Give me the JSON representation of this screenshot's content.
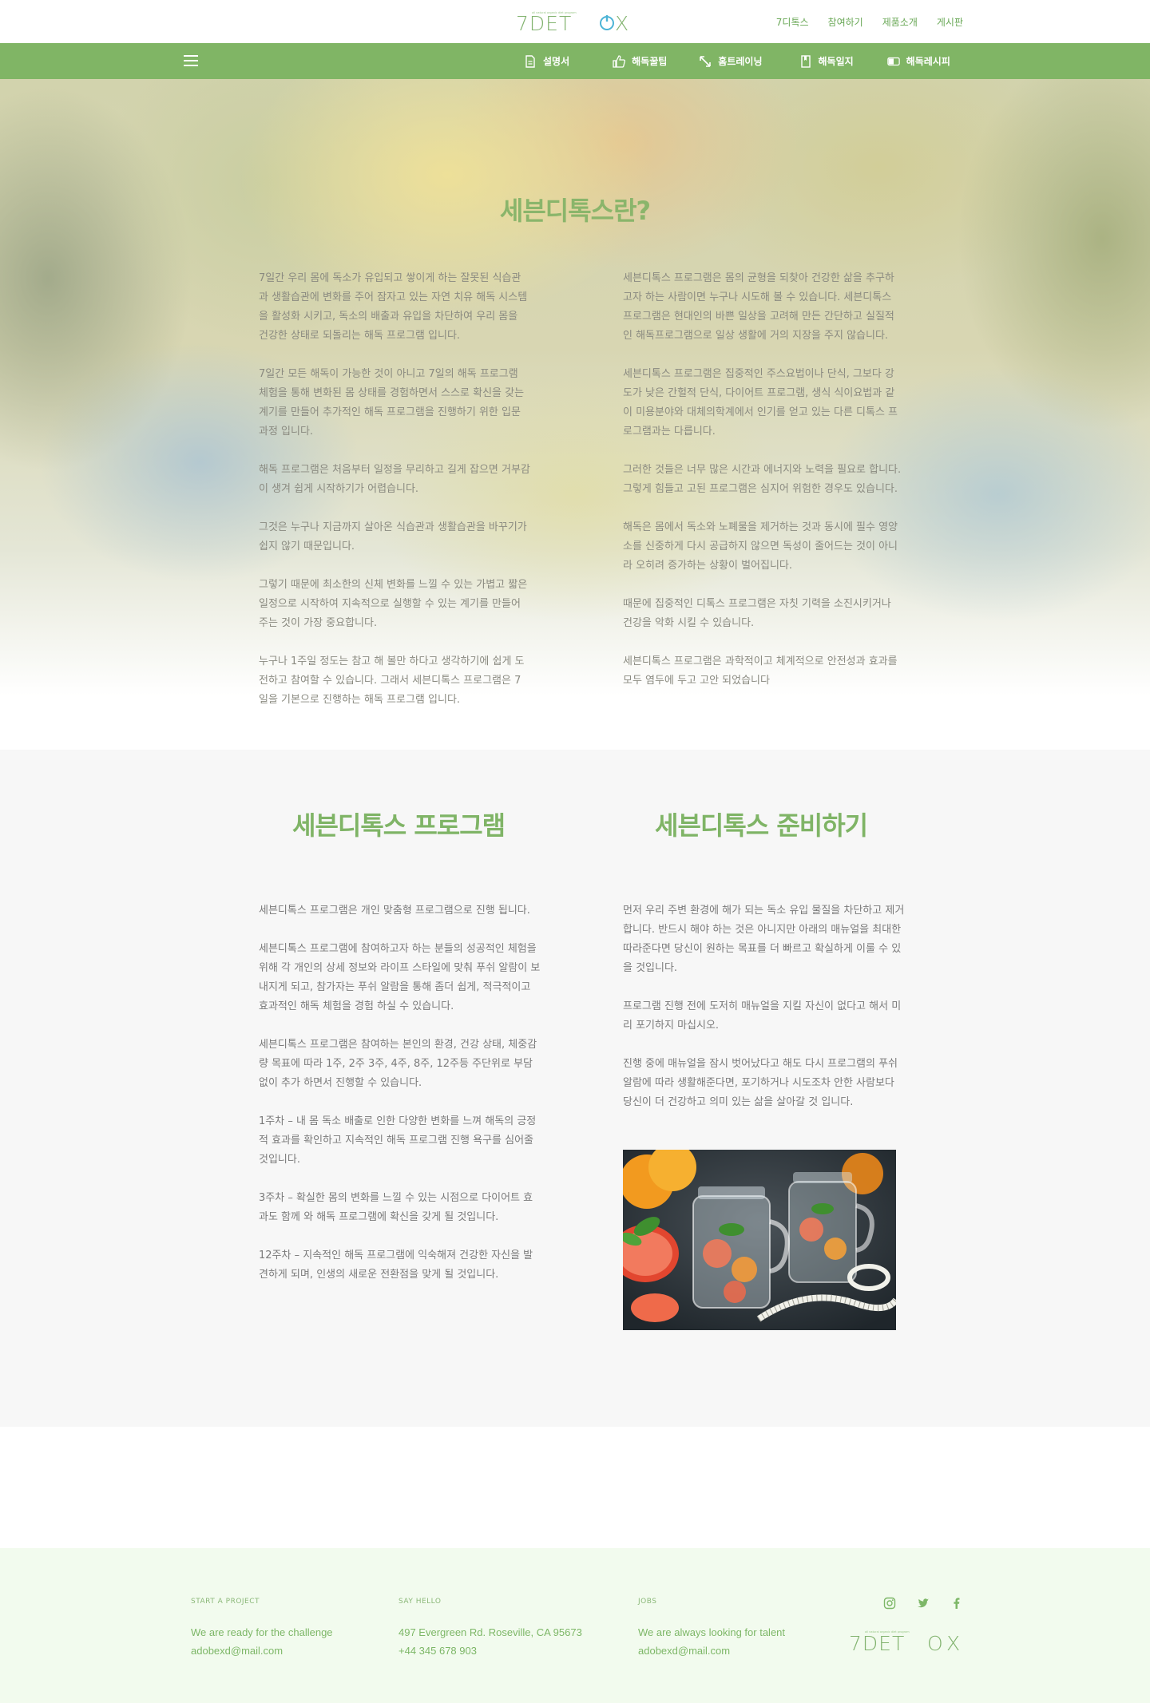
{
  "header": {
    "logo": {
      "tagline": "all natural organic diet program",
      "text_pre": "7DET",
      "text_o": "O",
      "text_post": "X"
    },
    "topnav": [
      "7디톡스",
      "참여하기",
      "제품소개",
      "게시판"
    ],
    "subnav": [
      {
        "label": "설명서",
        "icon": "document-icon"
      },
      {
        "label": "해독꿀팁",
        "icon": "thumbs-up-icon"
      },
      {
        "label": "홈트레이닝",
        "icon": "expand-icon"
      },
      {
        "label": "해독일지",
        "icon": "bookmark-icon"
      },
      {
        "label": "해독레시피",
        "icon": "toggle-icon"
      }
    ],
    "colors": {
      "green_bar": "#80b565",
      "accent": "#7fb466",
      "logo_power": "#4cb4d6"
    }
  },
  "hero": {
    "title": "세븐디톡스란?",
    "left_paragraphs": [
      "7일간 우리 몸에 독소가 유입되고 쌓이게 하는 잘못된 식습관과 생활습관에 변화를 주어 잠자고 있는 자연 치유 해독 시스템을 활성화 시키고, 독소의 배출과 유입을 차단하여 우리 몸을 건강한 상태로 되돌리는 해독 프로그램 입니다.",
      "7일간 모든 해독이 가능한 것이 아니고 7일의 해독 프로그램 체험을 통해 변화된 몸 상태를 경험하면서 스스로 확신을 갖는 계기를 만들어 추가적인 해독 프로그램을 진행하기 위한 입문 과정 입니다.",
      "해독 프로그램은 처음부터 일정을 무리하고 길게 잡으면 거부감이 생겨 쉽게 시작하기가 어렵습니다.",
      "그것은 누구나 지금까지 살아온 식습관과 생활습관을 바꾸기가 쉽지 않기 때문입니다.",
      "그렇기 때문에 최소한의 신체 변화를 느낄 수 있는 가볍고 짧은 일정으로 시작하여 지속적으로 실행할 수 있는 계기를 만들어 주는 것이 가장 중요합니다.",
      "누구나 1주일 정도는 참고 해 볼만 하다고 생각하기에 쉽게 도전하고 참여할 수 있습니다. 그래서 세븐디톡스 프로그램은 7일을 기본으로 진행하는 해독 프로그램 입니다."
    ],
    "right_paragraphs": [
      "세븐디톡스 프로그램은 몸의 균형을 되찾아 건강한 삶을 추구하고자 하는 사람이면 누구나 시도해 볼 수 있습니다. 세븐디톡스 프로그램은 현대인의 바쁜 일상을 고려해 만든 간단하고 실질적인 해독프로그램으로 일상 생활에 거의 지장을 주지 않습니다.",
      "세븐디톡스 프로그램은 집중적인 주스요법이나 단식, 그보다 강도가 낮은 간헐적 단식, 다이어트 프로그램, 생식 식이요법과 같이 미용분야와 대체의학계에서 인기를 얻고 있는 다른 디톡스 프로그램과는 다릅니다.",
      "그러한 것들은 너무 많은 시간과 에너지와 노력을 필요로 합니다. 그렇게 힘들고 고된 프로그램은 심지어 위험한 경우도 있습니다.",
      "해독은 몸에서 독소와 노폐물을 제거하는 것과 동시에 필수 영양소를 신중하게 다시 공급하지 않으면 독성이 줄어드는 것이 아니라 오히려 증가하는 상황이 벌어집니다.",
      "때문에 집중적인 디톡스 프로그램은 자칫 기력을 소진시키거나 건강을 악화 시킬 수 있습니다.",
      "세븐디톡스 프로그램은 과학적이고 체계적으로 안전성과 효과를 모두 염두에 두고 고안 되었습니다"
    ]
  },
  "program": {
    "left_title": "세븐디톡스 프로그램",
    "right_title": "세븐디톡스 준비하기",
    "left_paragraphs": [
      "세븐디톡스 프로그램은 개인 맞춤형 프로그램으로 진행 됩니다.",
      "세븐디톡스 프로그램에 참여하고자 하는 분들의 성공적인 체험을 위해 각 개인의 상세 정보와 라이프 스타일에 맞춰 푸쉬 알람이 보내지게 되고, 참가자는 푸쉬 알람을 통해 좀더 쉽게, 적극적이고 효과적인 해독 체험을 경험 하실 수 있습니다.",
      "세븐디톡스 프로그램은 참여하는 본인의 환경, 건강 상태, 체중감량 목표에 따라 1주, 2주 3주, 4주, 8주, 12주등 주단위로 부담 없이 추가 하면서 진행할 수 있습니다.",
      "1주차 – 내 몸 독소 배출로 인한 다양한 변화를 느껴 해독의 긍정적 효과를 확인하고 지속적인 해독 프로그램 진행 욕구를 심어줄 것입니다.",
      "3주차 – 확실한 몸의 변화를 느낄 수 있는 시점으로 다이어트 효과도 함께 와 해독 프로그램에 확신을 갖게 될 것입니다.",
      "12주차 – 지속적인 해독 프로그램에 익숙해져 건강한 자신을 발견하게 되며, 인생의 새로운 전환점을 맞게 될 것입니다."
    ],
    "right_paragraphs": [
      "먼저 우리 주변 환경에 해가 되는 독소 유입 물질을 차단하고 제거합니다. 반드시 해야 하는 것은 아니지만 아래의 매뉴얼을 최대한 따라준다면 당신이 원하는 목표를 더 빠르고 확실하게 이룰 수 있을 것입니다.",
      "프로그램 진행 전에 도저히 매뉴얼을 지킬 자신이 없다고 해서 미리 포기하지 마십시오.",
      "진행 중에 매뉴얼을 잠시 벗어났다고 해도 다시 프로그램의 푸쉬 알람에 따라 생활해준다면, 포기하거나 시도조차 안한 사람보다 당신이 더 건강하고 의미 있는 삶을 살아갈 것 입니다."
    ],
    "image_alt": "detox-water-photo"
  },
  "footer": {
    "columns": [
      {
        "label": "START A PROJECT",
        "lines": [
          "We are ready for the challenge",
          "adobexd@mail.com"
        ]
      },
      {
        "label": "SAY HELLO",
        "lines": [
          "497 Evergreen Rd. Roseville, CA 95673",
          "+44 345 678 903"
        ]
      },
      {
        "label": "JOBS",
        "lines": [
          "We are always looking for talent",
          "adobexd@mail.com"
        ]
      }
    ],
    "socials": [
      "instagram-icon",
      "twitter-icon",
      "facebook-icon"
    ]
  }
}
